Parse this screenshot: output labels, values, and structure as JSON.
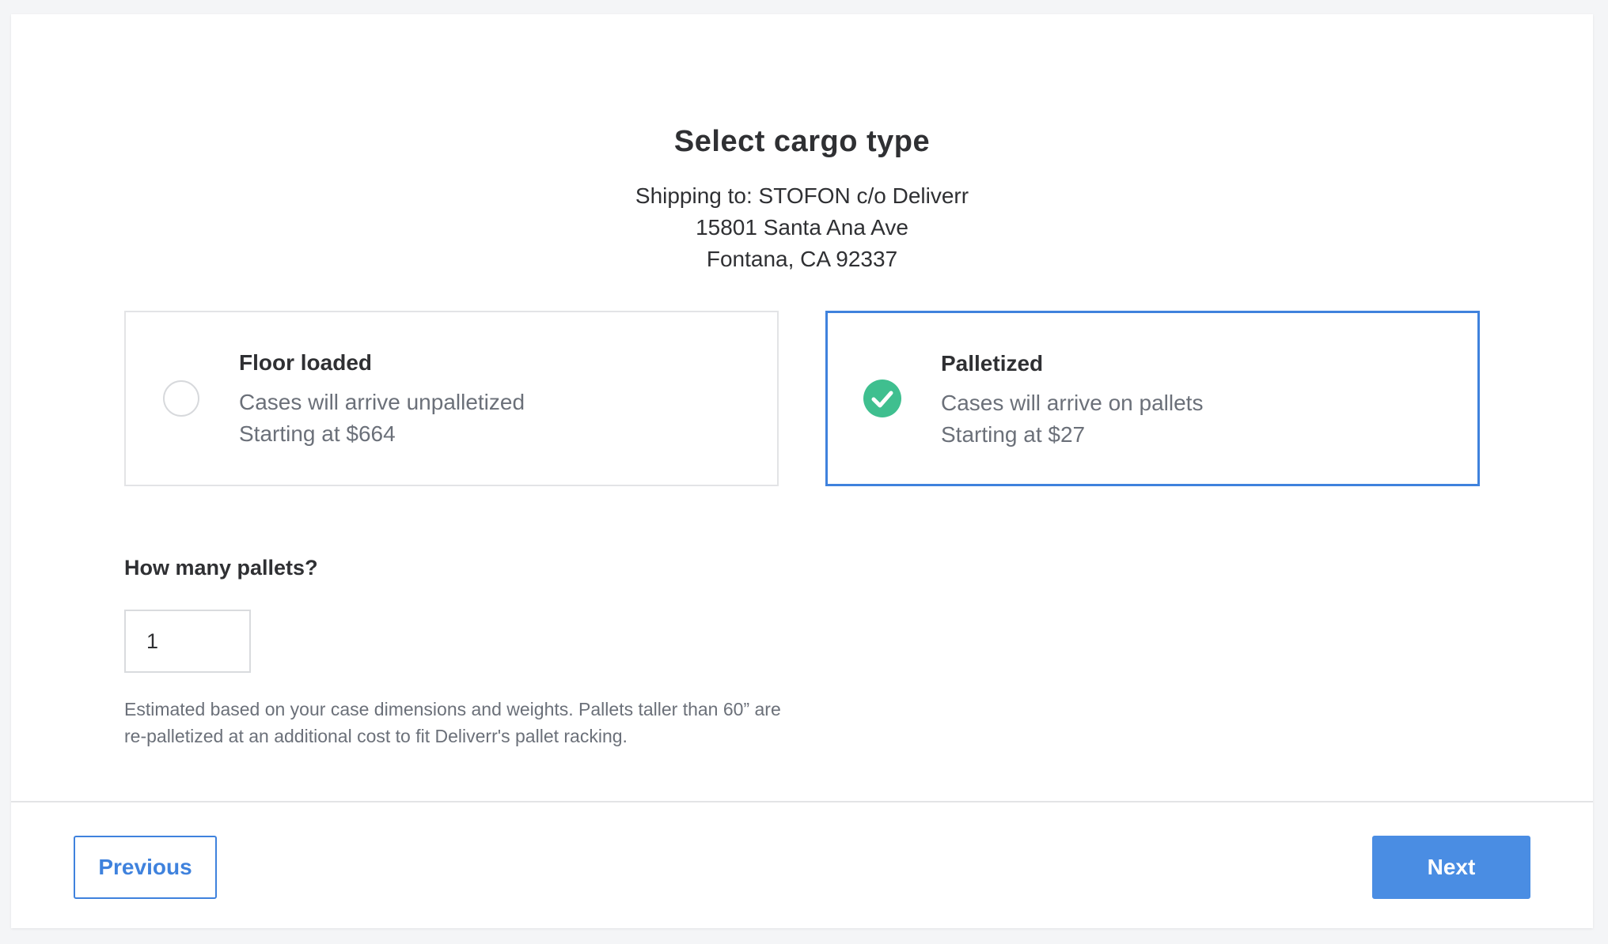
{
  "page": {
    "title": "Select cargo type",
    "shipping": {
      "line1": "Shipping to: STOFON c/o Deliverr",
      "line2": "15801 Santa Ana Ave",
      "line3": "Fontana, CA 92337"
    }
  },
  "options": [
    {
      "title": "Floor loaded",
      "description": "Cases will arrive unpalletized",
      "price": "Starting at $664",
      "selected": false
    },
    {
      "title": "Palletized",
      "description": "Cases will arrive on pallets",
      "price": "Starting at $27",
      "selected": true
    }
  ],
  "pallets": {
    "label": "How many pallets?",
    "value": "1",
    "help": "Estimated based on your case dimensions and weights. Pallets taller than 60” are re-palletized at an additional cost to fit Deliverr's pallet racking."
  },
  "footer": {
    "previous_label": "Previous",
    "next_label": "Next"
  },
  "colors": {
    "accent": "#3f82dd",
    "success": "#3fbf8f",
    "muted_text": "#6b7079"
  },
  "icons": {
    "unselected": "radio-empty-icon",
    "selected": "check-circle-icon"
  }
}
